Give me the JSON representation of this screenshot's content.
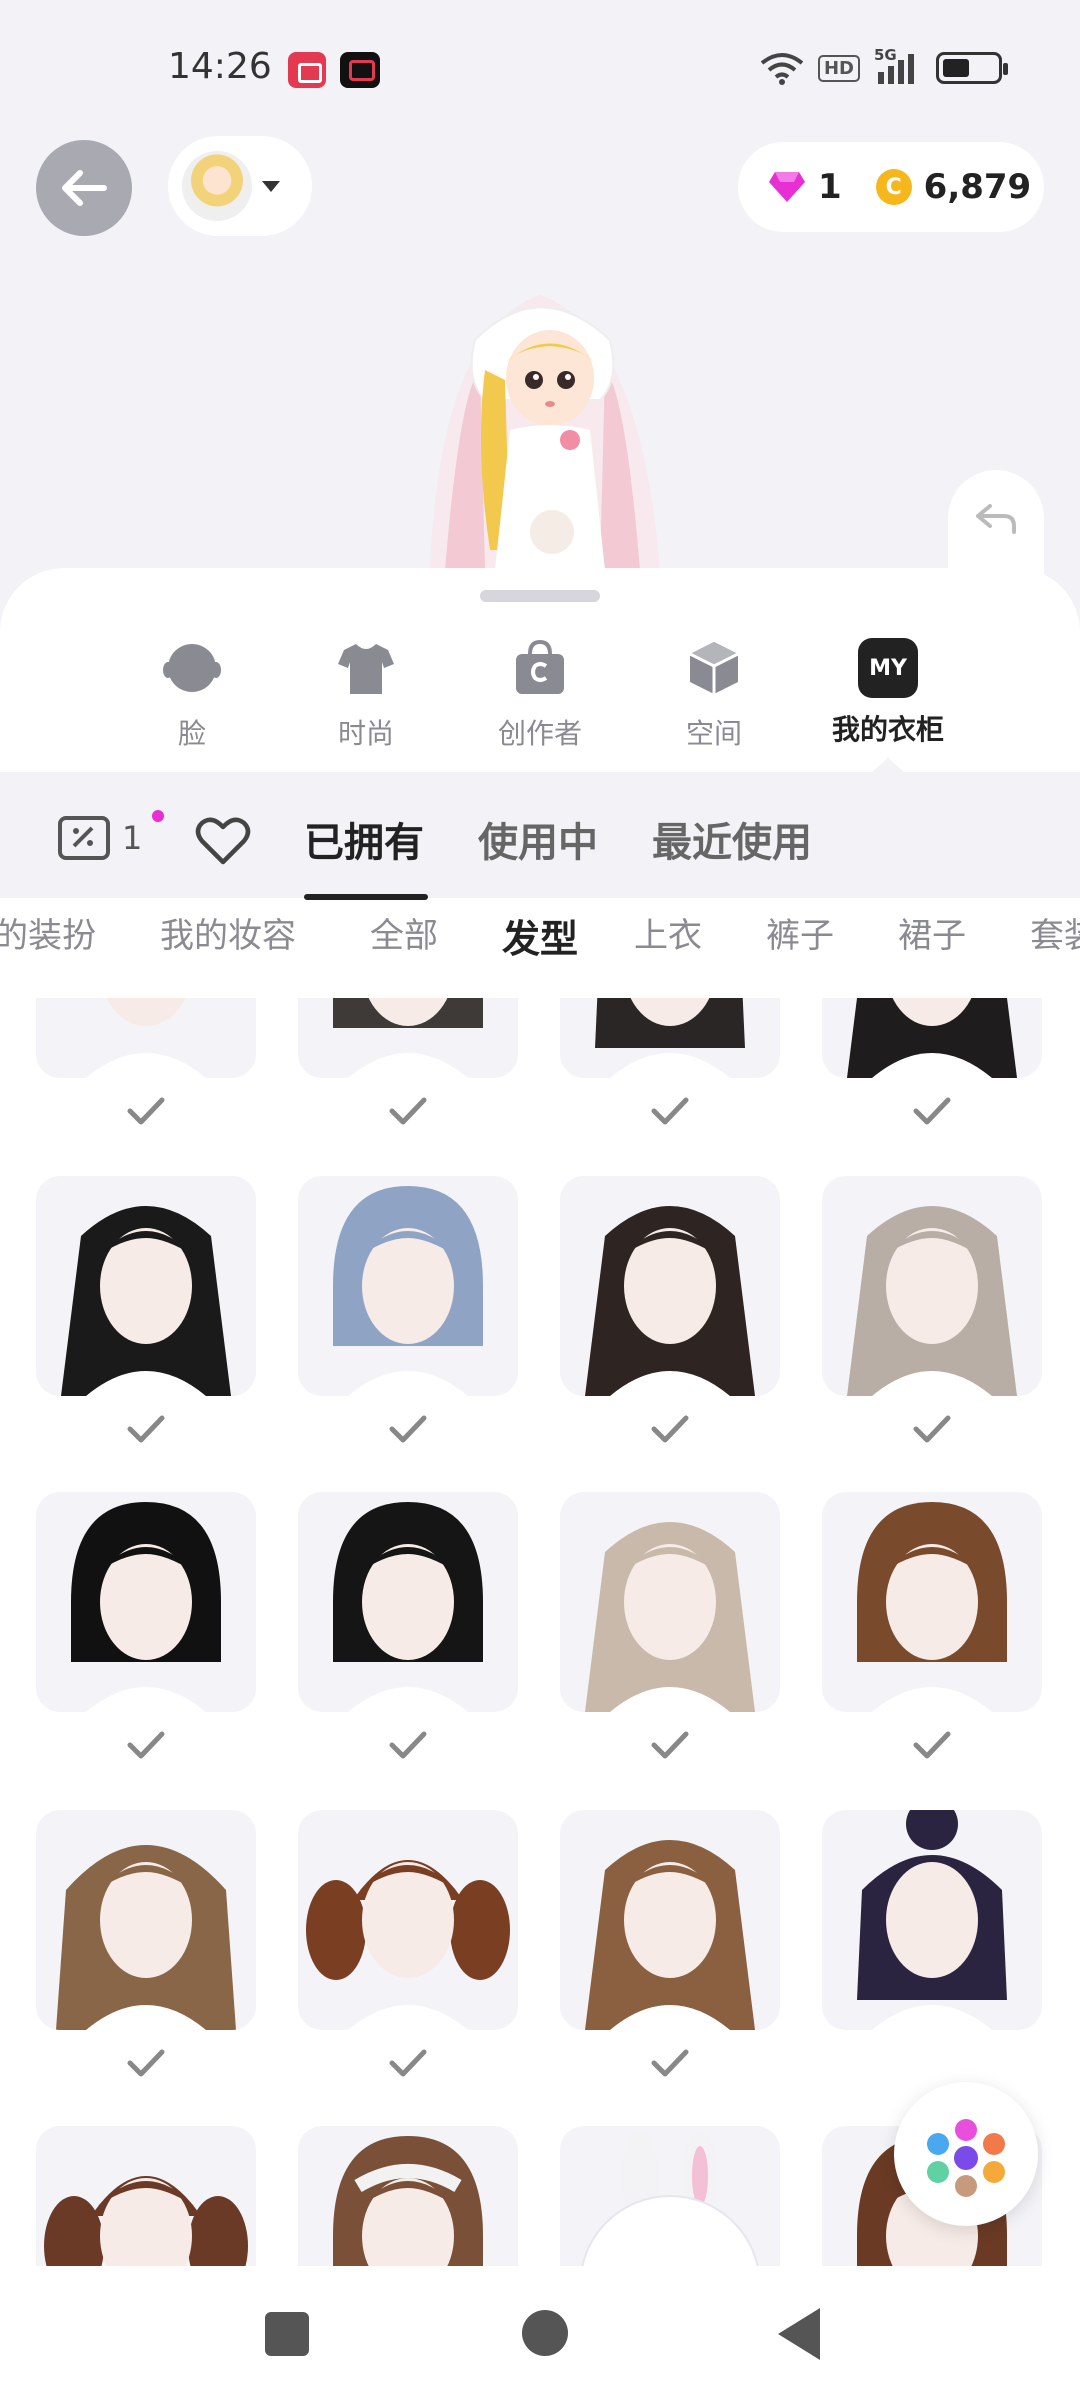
{
  "status_bar": {
    "time": "14:26",
    "network": "5G",
    "hd": "HD",
    "icons": [
      "screen-record-icon",
      "video-app-icon",
      "wifi-icon",
      "signal-icon",
      "battery-icon"
    ]
  },
  "header": {
    "currency": {
      "gems": "1",
      "coins": "6,879",
      "coin_symbol": "C"
    }
  },
  "categories": [
    {
      "label": "脸",
      "icon": "face-icon"
    },
    {
      "label": "时尚",
      "icon": "tshirt-icon"
    },
    {
      "label": "创作者",
      "icon": "creator-bag-icon"
    },
    {
      "label": "空间",
      "icon": "cube-icon"
    },
    {
      "label": "我的衣柜",
      "icon": "my-wardrobe-icon",
      "badge": "MY",
      "active": true
    }
  ],
  "tabs": {
    "coupon_count": "1",
    "items": [
      {
        "label": "已拥有",
        "active": true
      },
      {
        "label": "使用中"
      },
      {
        "label": "最近使用"
      }
    ]
  },
  "sub_tabs": [
    {
      "label": "的装扮"
    },
    {
      "label": "我的妆容"
    },
    {
      "label": "全部"
    },
    {
      "label": "发型",
      "active": true
    },
    {
      "label": "上衣"
    },
    {
      "label": "裤子"
    },
    {
      "label": "裙子"
    },
    {
      "label": "套装"
    }
  ],
  "colors": {
    "accent_dark": "#222222",
    "coupon_dot": "#e82fd4",
    "gem": "#e82fd4",
    "coin": "#f5b71b"
  },
  "grid": {
    "items": [
      {
        "hair": "pink braid",
        "owned": true
      },
      {
        "hair": "dark short wavy",
        "owned": true
      },
      {
        "hair": "black bun",
        "owned": true
      },
      {
        "hair": "black long",
        "owned": true
      },
      {
        "hair": "black long straight bangs",
        "owned": true
      },
      {
        "hair": "blue bob",
        "owned": true
      },
      {
        "hair": "dark long tied",
        "owned": true
      },
      {
        "hair": "ash long",
        "owned": true
      },
      {
        "hair": "black short bob",
        "owned": true
      },
      {
        "hair": "black shaggy",
        "owned": true
      },
      {
        "hair": "light brown long",
        "owned": true
      },
      {
        "hair": "brown short",
        "owned": true
      },
      {
        "hair": "brown bangs",
        "owned": true
      },
      {
        "hair": "brown pigtails",
        "owned": true
      },
      {
        "hair": "brown side part",
        "owned": true
      },
      {
        "hair": "navy high bun",
        "owned": false
      },
      {
        "hair": "brown pigtails",
        "owned": false
      },
      {
        "hair": "headband",
        "owned": false
      },
      {
        "hair": "bunny hat",
        "owned": false
      },
      {
        "hair": "brown",
        "owned": false
      }
    ]
  }
}
